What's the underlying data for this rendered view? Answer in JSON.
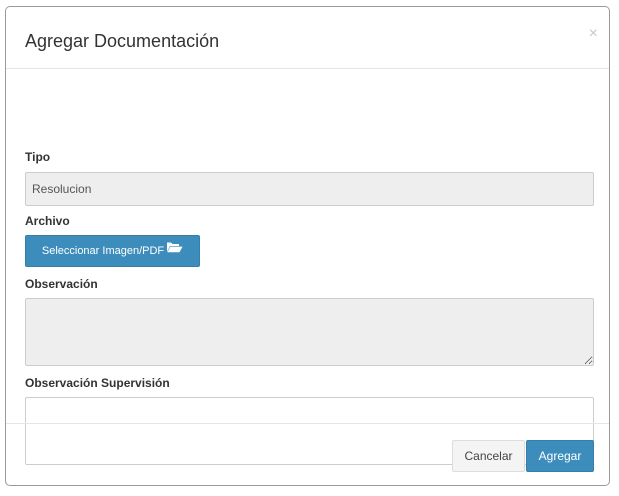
{
  "modal": {
    "title": "Agregar Documentación",
    "close_glyph": "×"
  },
  "form": {
    "tipo": {
      "label": "Tipo",
      "value": "Resolucion"
    },
    "archivo": {
      "label": "Archivo",
      "button_label": "Seleccionar Imagen/PDF",
      "button_icon": "folder-open-icon"
    },
    "observacion": {
      "label": "Observación",
      "value": ""
    },
    "observacion_supervision": {
      "label": "Observación Supervisión",
      "value": ""
    }
  },
  "footer": {
    "cancel_label": "Cancelar",
    "add_label": "Agregar"
  },
  "colors": {
    "primary": "#3c8dbc",
    "readonly_bg": "#eeeeee",
    "default_btn_bg": "#f4f4f4"
  }
}
